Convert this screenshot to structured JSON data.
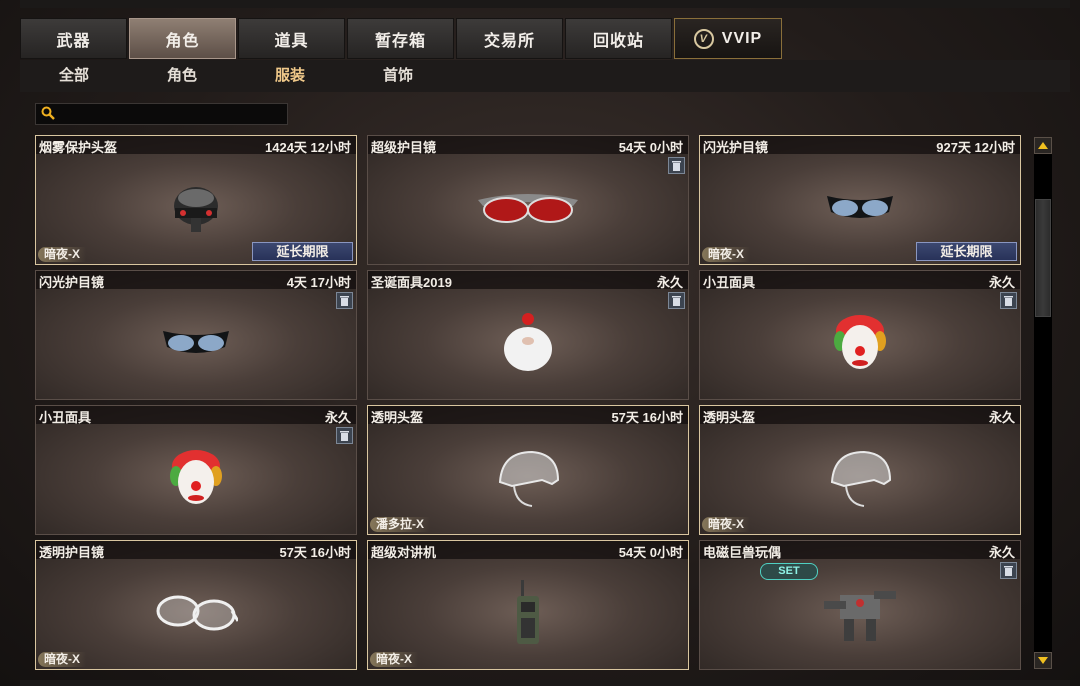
{
  "tabs": [
    {
      "label": "武器"
    },
    {
      "label": "角色"
    },
    {
      "label": "道具"
    },
    {
      "label": "暂存箱"
    },
    {
      "label": "交易所"
    },
    {
      "label": "回收站"
    },
    {
      "label": "VVIP"
    }
  ],
  "active_tab": "角色",
  "subtabs": [
    {
      "label": "全部"
    },
    {
      "label": "角色"
    },
    {
      "label": "服装"
    },
    {
      "label": "首饰"
    }
  ],
  "active_subtab": "服装",
  "search": {
    "value": ""
  },
  "vvip_badge": "V",
  "items": [
    {
      "name": "烟雾保护头盔",
      "duration": "1424天 12小时",
      "tag": "暗夜-X",
      "extend_label": "延长期限",
      "trash": false,
      "icon": "helmet-icon"
    },
    {
      "name": "超级护目镜",
      "duration": "54天 0小时",
      "tag": "",
      "extend_label": "",
      "trash": true,
      "icon": "red-goggles-icon"
    },
    {
      "name": "闪光护目镜",
      "duration": "927天 12小时",
      "tag": "暗夜-X",
      "extend_label": "延长期限",
      "trash": false,
      "icon": "dark-goggles-icon"
    },
    {
      "name": "闪光护目镜",
      "duration": "4天 17小时",
      "tag": "",
      "extend_label": "",
      "trash": true,
      "icon": "dark-goggles-icon"
    },
    {
      "name": "圣诞面具2019",
      "duration": "永久",
      "tag": "",
      "extend_label": "",
      "trash": true,
      "icon": "santa-mask-icon"
    },
    {
      "name": "小丑面具",
      "duration": "永久",
      "tag": "",
      "extend_label": "",
      "trash": true,
      "icon": "clown-mask-icon"
    },
    {
      "name": "小丑面具",
      "duration": "永久",
      "tag": "",
      "extend_label": "",
      "trash": true,
      "icon": "clown-mask-icon"
    },
    {
      "name": "透明头盔",
      "duration": "57天 16小时",
      "tag": "潘多拉-X",
      "extend_label": "",
      "trash": false,
      "icon": "clear-helmet-icon"
    },
    {
      "name": "透明头盔",
      "duration": "永久",
      "tag": "暗夜-X",
      "extend_label": "",
      "trash": false,
      "icon": "clear-helmet-icon"
    },
    {
      "name": "透明护目镜",
      "duration": "57天 16小时",
      "tag": "暗夜-X",
      "extend_label": "",
      "trash": false,
      "icon": "clear-goggles-icon"
    },
    {
      "name": "超级对讲机",
      "duration": "54天 0小时",
      "tag": "暗夜-X",
      "extend_label": "",
      "trash": false,
      "icon": "walkie-talkie-icon"
    },
    {
      "name": "电磁巨兽玩偶",
      "duration": "永久",
      "tag": "",
      "extend_label": "",
      "trash": true,
      "set_label": "SET",
      "icon": "mech-toy-icon"
    }
  ],
  "colors": {
    "accent_gold": "#f0c98a",
    "tab_active": "#8f7f73",
    "extend_button": "#283259",
    "set_badge": "#4fd0c2"
  }
}
